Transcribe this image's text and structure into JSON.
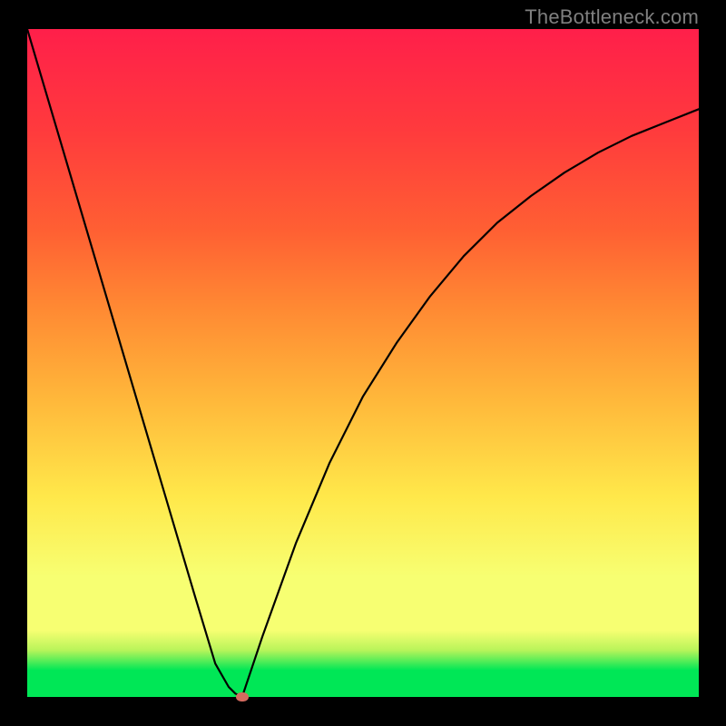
{
  "watermark": "TheBottleneck.com",
  "chart_data": {
    "type": "line",
    "title": "",
    "xlabel": "",
    "ylabel": "",
    "xlim": [
      0,
      100
    ],
    "ylim": [
      0,
      100
    ],
    "grid": false,
    "legend": false,
    "series": [
      {
        "name": "bottleneck-curve",
        "x": [
          0,
          5,
          10,
          15,
          20,
          25,
          28,
          30,
          31,
          32,
          35,
          40,
          45,
          50,
          55,
          60,
          65,
          70,
          75,
          80,
          85,
          90,
          95,
          100
        ],
        "values": [
          100,
          83,
          66,
          49,
          32,
          15,
          5,
          1.5,
          0.5,
          0,
          9,
          23,
          35,
          45,
          53,
          60,
          66,
          71,
          75,
          78.5,
          81.5,
          84,
          86,
          88
        ]
      }
    ],
    "optimum": {
      "x": 32,
      "y": 0
    },
    "background_gradient": {
      "stops": [
        {
          "pos": 0.0,
          "color": "#00e756"
        },
        {
          "pos": 0.04,
          "color": "#00e756"
        },
        {
          "pos": 0.07,
          "color": "#b8f45a"
        },
        {
          "pos": 0.1,
          "color": "#f7ff72"
        },
        {
          "pos": 0.18,
          "color": "#f7ff72"
        },
        {
          "pos": 0.3,
          "color": "#ffe84a"
        },
        {
          "pos": 0.45,
          "color": "#ffb63a"
        },
        {
          "pos": 0.58,
          "color": "#ff8a33"
        },
        {
          "pos": 0.7,
          "color": "#ff5f33"
        },
        {
          "pos": 0.85,
          "color": "#ff3a3d"
        },
        {
          "pos": 1.0,
          "color": "#ff1f4a"
        }
      ]
    }
  }
}
